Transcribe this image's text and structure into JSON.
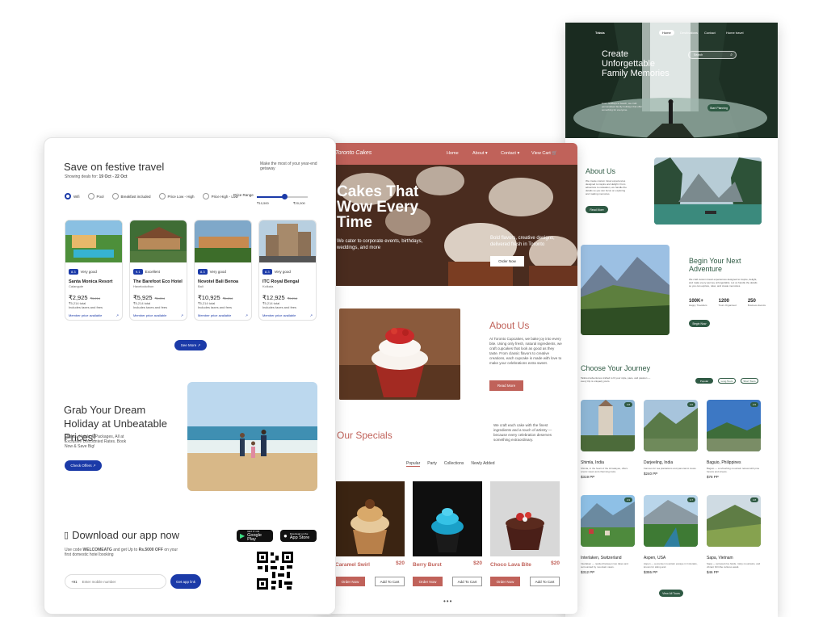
{
  "travel": {
    "brand": "Trăvia",
    "nav": [
      "Home",
      "Destinations",
      "Contact",
      "Home travel"
    ],
    "hero_title": "Create Unforgettable Family Memories",
    "search_placeholder": "Search",
    "hero_text": "From holidays to beach, we craft personalised family holidays that offer something for everyone.",
    "hero_btn": "Start Planning",
    "about_title": "About Us",
    "about_text": "We create custom travel experiences designed to inspire and delight. From adventure to relaxation, we handle the details so you can focus on exploring and making memories.",
    "about_btn": "Read More",
    "begin_title": "Begin Your Next Adventure",
    "begin_text": "We craft custom travel experiences designed to inspire, delight, and make every journey unforgettable. Let us handle the details so you can explore, relax, and create memories.",
    "stats": [
      {
        "value": "100K+",
        "label": "Happy Travellers"
      },
      {
        "value": "1200",
        "label": "Tours Organised"
      },
      {
        "value": "250",
        "label": "Business Events"
      }
    ],
    "begin_btn": "Begin Now",
    "journey_title": "Choose Your Journey",
    "journey_text": "Tailored adventures crafted to fit your style, pace, and passion — every trip is uniquely yours.",
    "filters": [
      "Popular",
      "Long Tours",
      "Short Tours"
    ],
    "destinations": [
      {
        "name": "Shimla, India",
        "desc": "Shimla, in the heart of the Himalayas, offers scenic views and charming treks.",
        "price": "$319 PP",
        "badge": "4.8"
      },
      {
        "name": "Darjeeling, India",
        "desc": "Famous for tea plantations and panoramic views.",
        "price": "$240 PP",
        "badge": "4.6"
      },
      {
        "name": "Baguio, Philippines",
        "desc": "Baguio — a refreshing mountain retreat with pine forests and streets.",
        "price": "$78 PP",
        "badge": "4.5"
      },
      {
        "name": "Interlaken, Switzerland",
        "desc": "Interlaken — nestled between two lakes and surrounded by mountain views.",
        "price": "$312 PP",
        "badge": "4.9"
      },
      {
        "name": "Aspen, USA",
        "desc": "Aspen — a premier mountain escape in Colorado, known for skiing and.",
        "price": "$355 PP",
        "badge": "4.7"
      },
      {
        "name": "Sapa, Vietnam",
        "desc": "Sapa — terraced rice fields, misty mountains, and vibrant hill tribe cultures await.",
        "price": "$46 PP",
        "badge": "4.8"
      }
    ],
    "view_all": "View All Tours",
    "green": "#2f5a44"
  },
  "cakes": {
    "brand": "Toronto Cakes",
    "nav": [
      "Home",
      "About ▾",
      "Contact ▾",
      "View Cart 🛒"
    ],
    "hero_title": "Cakes That Wow Every Time",
    "hero_text": "We cater to corporate events, birthdays, weddings, and more",
    "hero_right": "Bold flavors, creative designs, delivered fresh in Toronto",
    "order_btn": "Order Now",
    "about_title": "About Us",
    "about_text": "At Toronto Cupcakes, we bake joy into every bite. Using only fresh, natural ingredients, we craft cupcakes that look as good as they taste. From classic flavors to creative creations, each cupcake is made with love to make your celebrations extra sweet.",
    "read_more": "Read More",
    "specials_title": "Our Specials",
    "specials_text": "We craft each cake with the finest ingredients and a touch of artistry — because every celebration deserves something extraordinary.",
    "tabs": [
      "Popular",
      "Party",
      "Collections",
      "Newly Added"
    ],
    "products": [
      {
        "name": "Caramel Swirl",
        "price": "$20"
      },
      {
        "name": "Berry Burst",
        "price": "$20"
      },
      {
        "name": "Choco Lava Bite",
        "price": "$20"
      }
    ],
    "order_label": "Order Now",
    "cart_label": "Add To Cart",
    "red": "#c0625a"
  },
  "hotels": {
    "title": "Save on festive travel",
    "dates_prefix": "Showing deals for:",
    "dates": "19 Oct - 22 Oct",
    "tagline": "Make the most of your year-end getaway",
    "filters": [
      "Wifi",
      "Pool",
      "Breakfast included",
      "Price Low - High",
      "Price High - Low"
    ],
    "price_range_label": "Price Range",
    "price_min": "₹10,500",
    "price_max": "₹20,000",
    "cards": [
      {
        "score": "8.3",
        "rating": "Very good",
        "name": "Santa Monica Resort",
        "loc": "Calangute",
        "price": "₹2,925",
        "old": "₹5,214",
        "total": "₹5,214 total"
      },
      {
        "score": "9.1",
        "rating": "Excellent",
        "name": "The Barefoot Eco Hotel",
        "loc": "Havelockdhon",
        "price": "₹5,925",
        "old": "₹5,214",
        "total": "₹5,214 total"
      },
      {
        "score": "8.3",
        "rating": "Very good",
        "name": "Novotel Bali Benoa",
        "loc": "Bali",
        "price": "₹10,925",
        "old": "₹5,214",
        "total": "₹5,214 total"
      },
      {
        "score": "8.3",
        "rating": "Very good",
        "name": "ITC Royal Bengal",
        "loc": "Kolkata",
        "price": "₹12,925",
        "old": "₹5,214",
        "total": "₹5,214 total"
      }
    ],
    "includes": "Includes taxes and fees",
    "member": "Member price available",
    "see_more": "See More ↗",
    "grab_title": "Grab Your Dream Holiday at Unbeatable Prices!",
    "grab_text": "Flights, Hotels & Packages, All at Exclusive Discounted Rates. Book Now & Save Big!",
    "check_offers": "Check Offers ↗",
    "app_title": "Download our app now",
    "app_text_1": "Use code",
    "code": "WELCOMEATG",
    "app_text_2": "and get Up to",
    "discount": "Rs.5000 OFF",
    "app_text_3": "on your first domestic hotel booking",
    "phone_prefix": "+91",
    "phone_placeholder": "Enter mobile number",
    "get_link": "Get app link",
    "google_play_small": "GET IT ON",
    "google_play": "Google Play",
    "app_store_small": "Download on the",
    "app_store": "App Store",
    "blue": "#1b3aa8"
  }
}
